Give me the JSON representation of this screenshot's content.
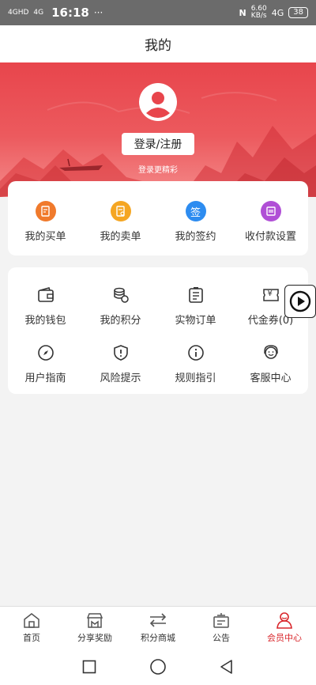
{
  "status": {
    "network_left": "4GHD",
    "network_left2": "4G",
    "time": "16:18",
    "dots": "···",
    "speed_top": "6.60",
    "speed_unit": "KB/s",
    "network_right": "4G",
    "battery": "38"
  },
  "header": {
    "title": "我的"
  },
  "profile": {
    "login_button": "登录/注册",
    "login_hint": "登录更精彩"
  },
  "quick_actions": [
    {
      "label": "我的买单",
      "icon": "buy-order-icon",
      "color": "#f07a2c"
    },
    {
      "label": "我的卖单",
      "icon": "sell-order-icon",
      "color": "#f5a623"
    },
    {
      "label": "我的签约",
      "icon": "sign-icon",
      "glyph": "签",
      "color": "#2d8cf0"
    },
    {
      "label": "收付款设置",
      "icon": "payment-settings-icon",
      "color": "#b04fd6"
    }
  ],
  "services": [
    {
      "label": "我的钱包",
      "icon": "wallet-icon"
    },
    {
      "label": "我的积分",
      "icon": "coins-icon"
    },
    {
      "label": "实物订单",
      "icon": "order-list-icon"
    },
    {
      "label": "代金券(0)",
      "icon": "voucher-icon",
      "glyph": "¥"
    },
    {
      "label": "用户指南",
      "icon": "compass-icon"
    },
    {
      "label": "风险提示",
      "icon": "shield-alert-icon"
    },
    {
      "label": "规则指引",
      "icon": "info-icon"
    },
    {
      "label": "客服中心",
      "icon": "customer-service-icon"
    }
  ],
  "tabs": [
    {
      "label": "首页",
      "icon": "home-icon"
    },
    {
      "label": "分享奖励",
      "icon": "share-store-icon"
    },
    {
      "label": "积分商城",
      "icon": "exchange-icon"
    },
    {
      "label": "公告",
      "icon": "notice-icon"
    },
    {
      "label": "会员中心",
      "icon": "member-icon",
      "active": true
    }
  ],
  "colors": {
    "accent": "#d9262b",
    "banner": "#e8454c"
  }
}
